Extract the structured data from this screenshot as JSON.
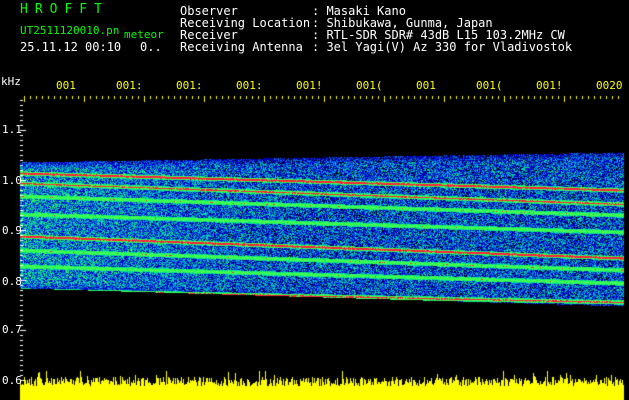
{
  "header": {
    "title": "HROFFT",
    "filename": "UT2511120010.pn",
    "mode": "meteor",
    "datetime": "25.11.12 00:10",
    "counter": "0..",
    "labels": [
      "Observer",
      "Receiving Location",
      "Receiver",
      "Receiving Antenna"
    ],
    "values": [
      ": Masaki Kano",
      ": Shibukawa, Gunma, Japan",
      ": RTL-SDR SDR# 43dB L15 103.2MHz CW",
      ": 3el Yagi(V) Az 330 for Vladivostok"
    ]
  },
  "time_axis": {
    "labels": [
      "001",
      "001:",
      "001:",
      "001:",
      "001!",
      "001(",
      "001",
      "001(",
      "001!",
      "0020"
    ]
  },
  "freq_axis": {
    "unit": "kHz",
    "ticks": [
      "1.1",
      "1.0",
      "0.9",
      "0.8",
      "0.7",
      "0.6"
    ]
  },
  "colors": {
    "background": "#000000",
    "signal_low": "#0000cc",
    "signal_mid": "#00ff88",
    "signal_high": "#ff2040",
    "level_bar": "#ffff00"
  }
}
